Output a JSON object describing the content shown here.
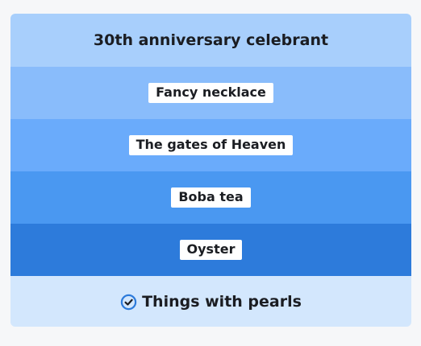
{
  "puzzle": {
    "title": "30th anniversary celebrant",
    "items": [
      {
        "label": "Fancy necklace"
      },
      {
        "label": "The gates of Heaven"
      },
      {
        "label": "Boba tea"
      },
      {
        "label": "Oyster"
      }
    ],
    "answer": {
      "label": "Things with pearls",
      "icon": "check-circle-icon"
    }
  },
  "colors": {
    "title_bg": "#a8cffc",
    "row_1": "#89bcfb",
    "row_2": "#6aabfb",
    "row_3": "#4a98f1",
    "row_4": "#2d7bdb",
    "footer_bg": "#d3e7fd",
    "icon": "#2d7bdb"
  }
}
